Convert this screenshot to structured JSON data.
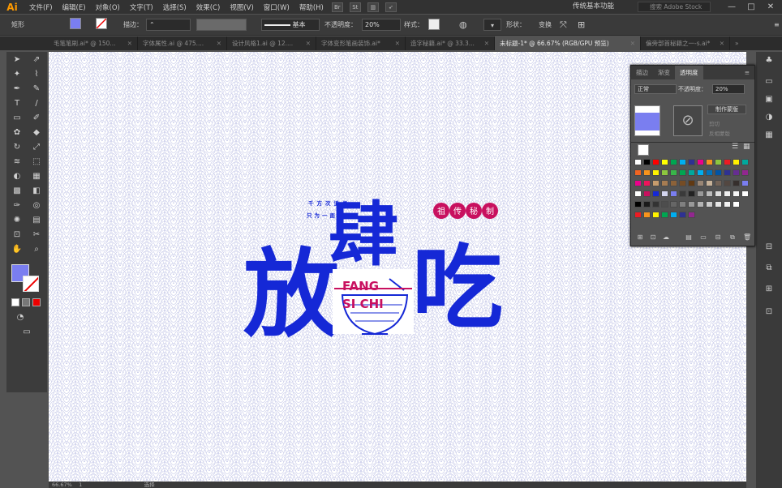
{
  "app": {
    "logo": "Ai"
  },
  "menu": [
    "文件(F)",
    "编辑(E)",
    "对象(O)",
    "文字(T)",
    "选择(S)",
    "效果(C)",
    "视图(V)",
    "窗口(W)",
    "帮助(H)"
  ],
  "menu_icons": [
    "Br",
    "St"
  ],
  "workspace": "传统基本功能",
  "stock_search_placeholder": "搜索 Adobe Stock",
  "window_buttons": [
    "—",
    "□",
    "✕"
  ],
  "control": {
    "object_type": "矩形",
    "stroke_label": "描边：",
    "stroke_style": "基本",
    "opacity_label": "不透明度：",
    "opacity_value": "20%",
    "style_label": "样式：",
    "shape_label": "形状：",
    "transform_label": "变换"
  },
  "tabs": [
    {
      "label": "毛笔笔刷.ai* @ 150...",
      "active": false
    },
    {
      "label": "字体属性.ai @ 475....",
      "active": false
    },
    {
      "label": "设计风格1.ai @ 12....",
      "active": false
    },
    {
      "label": "字体变形笔画装饰.ai*",
      "active": false
    },
    {
      "label": "造字秘籍.ai* @ 33.3...",
      "active": false
    },
    {
      "label": "未标题-1* @ 66.67% (RGB/GPU 预览)",
      "active": true
    },
    {
      "label": "偏旁部首秘籍之一-s.ai*",
      "active": false
    }
  ],
  "tabs_overflow": "»",
  "artwork": {
    "tagline_1": "千方次追寻",
    "tagline_2": "只为一面之缘",
    "badge_chars": [
      "祖",
      "传",
      "秘",
      "制"
    ],
    "title_chars": [
      "放",
      "肆",
      "吃"
    ],
    "pinyin_1": "FANG",
    "pinyin_2": "SI CHI",
    "colors": {
      "blue": "#1528d6",
      "red": "#c8105f",
      "pattern": "#d3d5ee"
    }
  },
  "panel": {
    "tabs": [
      "描边",
      "渐变",
      "透明度"
    ],
    "blend_mode": "正常",
    "opacity_label": "不透明度：",
    "opacity_value": "20%",
    "make_mask": "制作蒙版",
    "clip_label": "剪切",
    "invert_label": "反相蒙版"
  },
  "status": {
    "zoom": "66.67%",
    "page": "1",
    "tool": "选择"
  },
  "tools": [
    "selection-tool",
    "direct-selection-tool",
    "magic-wand-tool",
    "lasso-tool",
    "pen-tool",
    "curvature-tool",
    "type-tool",
    "line-tool",
    "rectangle-tool",
    "paintbrush-tool",
    "shaper-tool",
    "eraser-tool",
    "rotate-tool",
    "scale-tool",
    "width-tool",
    "free-transform-tool",
    "shape-builder-tool",
    "perspective-tool",
    "mesh-tool",
    "gradient-tool",
    "eyedropper-tool",
    "blend-tool",
    "symbol-sprayer-tool",
    "column-graph-tool",
    "artboard-tool",
    "slice-tool",
    "hand-tool",
    "zoom-tool"
  ],
  "tool_glyphs": [
    "➤",
    "⇗",
    "✦",
    "⌇",
    "✒",
    "✎",
    "T",
    "/",
    "▭",
    "✐",
    "✿",
    "◆",
    "↻",
    "⤢",
    "≋",
    "⬚",
    "◐",
    "▦",
    "▩",
    "◧",
    "✑",
    "◎",
    "✺",
    "▤",
    "⊡",
    "✂",
    "✋",
    "⌕"
  ],
  "dock_icons": [
    "club-icon",
    "layers-icon",
    "properties-icon",
    "color-icon",
    "swatches-icon",
    "align-icon",
    "pathfinder-icon",
    "transform-icon",
    "artboards-icon"
  ],
  "dock_glyphs": [
    "♣",
    "▭",
    "▣",
    "◑",
    "▦",
    "⊟",
    "⧉",
    "⊞",
    "⊡"
  ]
}
